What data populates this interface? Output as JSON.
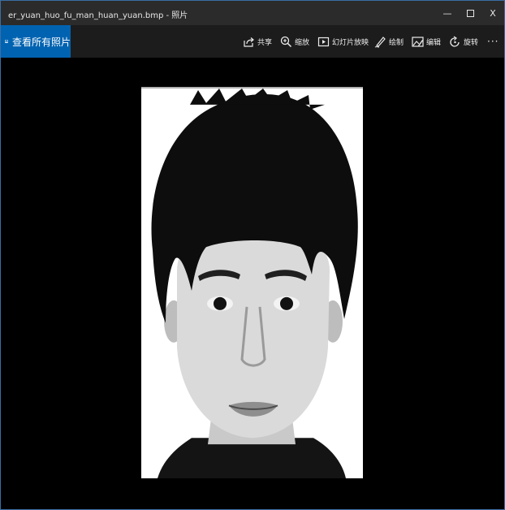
{
  "window": {
    "title": "er_yuan_huo_fu_man_huan_yuan.bmp - 照片",
    "controls": {
      "minimize": "—",
      "maximize": "",
      "close": "X"
    }
  },
  "toolbar": {
    "see_all": "查看所有照片",
    "share": "共享",
    "zoom": "缩放",
    "slideshow": "幻灯片放映",
    "draw": "绘制",
    "edit": "编辑",
    "rotate": "旋转",
    "more": "···"
  },
  "icons": {
    "see_all": "photos-icon",
    "share": "share-icon",
    "zoom": "zoom-icon",
    "slideshow": "slideshow-icon",
    "draw": "pen-icon",
    "edit": "edit-image-icon",
    "rotate": "rotate-icon"
  },
  "colors": {
    "accent": "#0063b1",
    "titlebar": "#2b2b2b",
    "toolbar": "#1c1c1c",
    "background": "#000000"
  }
}
